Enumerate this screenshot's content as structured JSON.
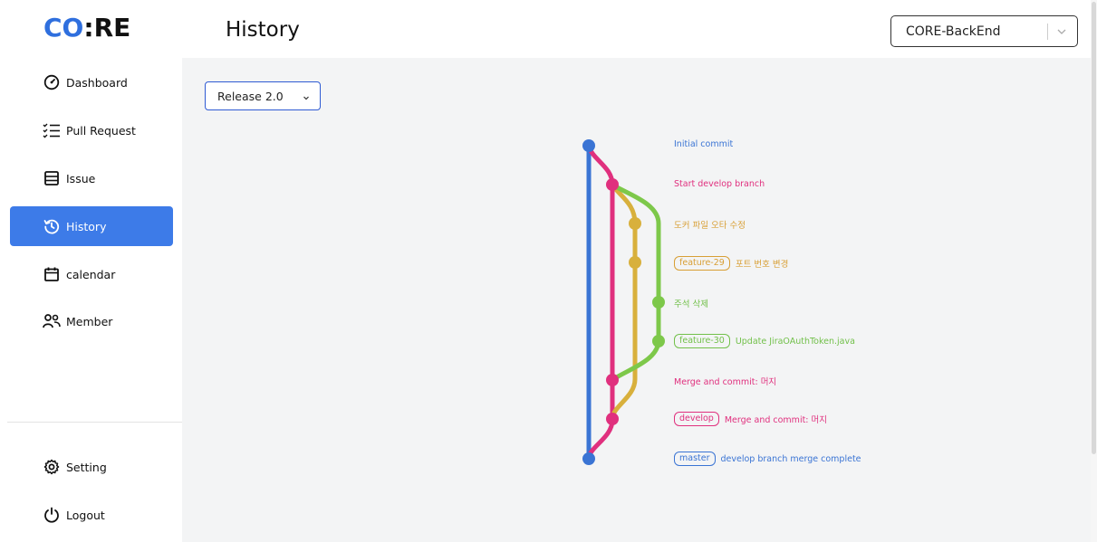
{
  "logo": {
    "part1": "CO",
    "part2": ":",
    "part3": "RE"
  },
  "header": {
    "title": "History",
    "project_select_value": "CORE-BackEnd"
  },
  "sidebar": {
    "items": [
      {
        "label": "Dashboard",
        "icon": "gauge-icon"
      },
      {
        "label": "Pull Request",
        "icon": "checklist-icon"
      },
      {
        "label": "Issue",
        "icon": "issue-icon"
      },
      {
        "label": "History",
        "icon": "history-icon",
        "active": true
      },
      {
        "label": "calendar",
        "icon": "calendar-icon"
      },
      {
        "label": "Member",
        "icon": "members-icon"
      }
    ],
    "bottom": [
      {
        "label": "Setting",
        "icon": "gear-icon"
      },
      {
        "label": "Logout",
        "icon": "power-icon"
      }
    ]
  },
  "release_select": {
    "value": "Release 2.0"
  },
  "commits": [
    {
      "message": "Initial commit",
      "tag": "",
      "branch": "master"
    },
    {
      "message": "Start develop branch",
      "tag": "",
      "branch": "develop"
    },
    {
      "message": "도커 파일 오타 수정",
      "tag": "",
      "branch": "feature-29"
    },
    {
      "message": "포트 번호 변경",
      "tag": "feature-29",
      "branch": "feature-29"
    },
    {
      "message": "주석 삭제",
      "tag": "",
      "branch": "feature-30"
    },
    {
      "message": "Update JiraOAuthToken.java",
      "tag": "feature-30",
      "branch": "feature-30"
    },
    {
      "message": "Merge and commit: 머지",
      "tag": "",
      "branch": "develop"
    },
    {
      "message": "Merge and commit: 머지",
      "tag": "develop",
      "branch": "develop"
    },
    {
      "message": "develop branch merge complete",
      "tag": "master",
      "branch": "master"
    }
  ],
  "colors": {
    "accent": "#3d7be8",
    "master": "#3a74d4",
    "develop": "#e0307e",
    "feature-29": "#d8b03c",
    "feature-30": "#7dc84a",
    "feature-29-text": "#d89f35",
    "feature-30-text": "#72c04a"
  }
}
